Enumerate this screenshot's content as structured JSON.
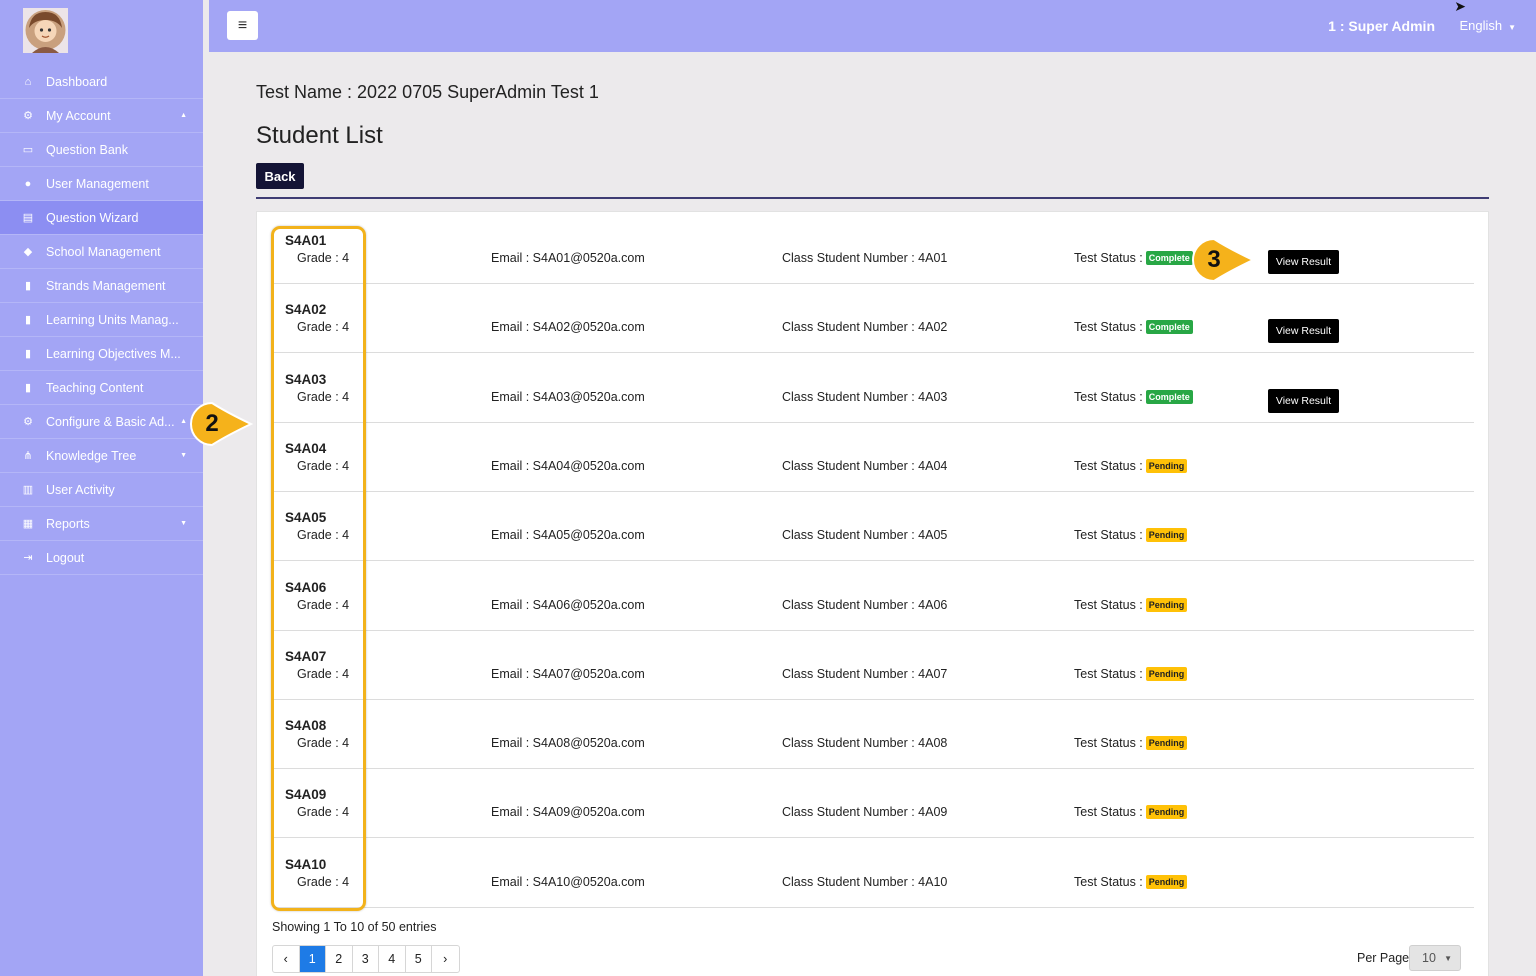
{
  "sidebar": {
    "items": [
      {
        "label": "Dashboard",
        "icon": "home-icon",
        "glyph": "⌂",
        "caret": ""
      },
      {
        "label": "My Account",
        "icon": "cogs-icon",
        "glyph": "⚙",
        "caret": "▲"
      },
      {
        "label": "Question Bank",
        "icon": "laptop-icon",
        "glyph": "▭",
        "caret": ""
      },
      {
        "label": "User Management",
        "icon": "user-icon",
        "glyph": "●",
        "caret": ""
      },
      {
        "label": "Question Wizard",
        "icon": "book-icon",
        "glyph": "▤",
        "caret": ""
      },
      {
        "label": "School Management",
        "icon": "graduation-cap-icon",
        "glyph": "◆",
        "caret": ""
      },
      {
        "label": "Strands Management",
        "icon": "file-icon",
        "glyph": "▮",
        "caret": ""
      },
      {
        "label": "Learning Units Manag...",
        "icon": "file-icon",
        "glyph": "▮",
        "caret": ""
      },
      {
        "label": "Learning Objectives M...",
        "icon": "file-icon",
        "glyph": "▮",
        "caret": ""
      },
      {
        "label": "Teaching Content",
        "icon": "file-icon",
        "glyph": "▮",
        "caret": ""
      },
      {
        "label": "Configure & Basic Ad...",
        "icon": "cogs-icon",
        "glyph": "⚙",
        "caret": "▲"
      },
      {
        "label": "Knowledge Tree",
        "icon": "sitemap-icon",
        "glyph": "⋔",
        "caret": "▼"
      },
      {
        "label": "User Activity",
        "icon": "bar-chart-icon",
        "glyph": "▥",
        "caret": ""
      },
      {
        "label": "Reports",
        "icon": "table-icon",
        "glyph": "▦",
        "caret": "▼"
      },
      {
        "label": "Logout",
        "icon": "sign-out-icon",
        "glyph": "⇥",
        "caret": ""
      }
    ],
    "active_index": 4
  },
  "topbar": {
    "menu_glyph": "≡",
    "user": "1 : Super Admin",
    "language": "English",
    "language_caret": "▼"
  },
  "main": {
    "test_name": "Test Name : 2022 0705 SuperAdmin Test 1",
    "title": "Student List",
    "back_label": "Back",
    "view_result_label": "View Result",
    "students": [
      {
        "id": "S4A01",
        "grade": "Grade : 4",
        "email": "Email : S4A01@0520a.com",
        "csn": "Class Student Number : 4A01",
        "status_label": "Test Status :",
        "status": "Complete",
        "has_result": true
      },
      {
        "id": "S4A02",
        "grade": "Grade : 4",
        "email": "Email : S4A02@0520a.com",
        "csn": "Class Student Number : 4A02",
        "status_label": "Test Status :",
        "status": "Complete",
        "has_result": true
      },
      {
        "id": "S4A03",
        "grade": "Grade : 4",
        "email": "Email : S4A03@0520a.com",
        "csn": "Class Student Number : 4A03",
        "status_label": "Test Status :",
        "status": "Complete",
        "has_result": true
      },
      {
        "id": "S4A04",
        "grade": "Grade : 4",
        "email": "Email : S4A04@0520a.com",
        "csn": "Class Student Number : 4A04",
        "status_label": "Test Status :",
        "status": "Pending",
        "has_result": false
      },
      {
        "id": "S4A05",
        "grade": "Grade : 4",
        "email": "Email : S4A05@0520a.com",
        "csn": "Class Student Number : 4A05",
        "status_label": "Test Status :",
        "status": "Pending",
        "has_result": false
      },
      {
        "id": "S4A06",
        "grade": "Grade : 4",
        "email": "Email : S4A06@0520a.com",
        "csn": "Class Student Number : 4A06",
        "status_label": "Test Status :",
        "status": "Pending",
        "has_result": false
      },
      {
        "id": "S4A07",
        "grade": "Grade : 4",
        "email": "Email : S4A07@0520a.com",
        "csn": "Class Student Number : 4A07",
        "status_label": "Test Status :",
        "status": "Pending",
        "has_result": false
      },
      {
        "id": "S4A08",
        "grade": "Grade : 4",
        "email": "Email : S4A08@0520a.com",
        "csn": "Class Student Number : 4A08",
        "status_label": "Test Status :",
        "status": "Pending",
        "has_result": false
      },
      {
        "id": "S4A09",
        "grade": "Grade : 4",
        "email": "Email : S4A09@0520a.com",
        "csn": "Class Student Number : 4A09",
        "status_label": "Test Status :",
        "status": "Pending",
        "has_result": false
      },
      {
        "id": "S4A10",
        "grade": "Grade : 4",
        "email": "Email : S4A10@0520a.com",
        "csn": "Class Student Number : 4A10",
        "status_label": "Test Status :",
        "status": "Pending",
        "has_result": false
      }
    ],
    "showing": "Showing 1 To 10 of 50 entries",
    "pagination": {
      "prev": "‹",
      "pages": [
        "1",
        "2",
        "3",
        "4",
        "5"
      ],
      "current": "1",
      "next": "›"
    },
    "per_page_label": "Per Page",
    "per_page_value": "10"
  },
  "annotations": {
    "callouts": [
      "2",
      "3"
    ],
    "highlight_color": "#f2b21b"
  },
  "colors": {
    "sidebar_bg": "#a3a5f5",
    "active_item_bg": "#8c8ef2",
    "back_button_bg": "#141436",
    "complete": "#28a745",
    "pending": "#ffc107",
    "page_active": "#1e7be6"
  }
}
